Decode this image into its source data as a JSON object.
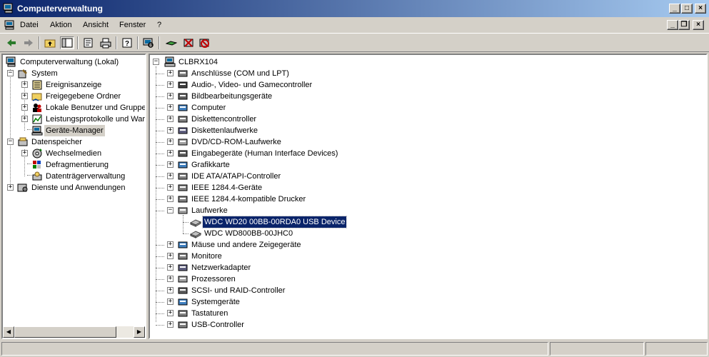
{
  "window": {
    "title": "Computerverwaltung"
  },
  "title_buttons": {
    "minimize": "_",
    "maximize": "□",
    "close": "×"
  },
  "menu": [
    {
      "label": "Datei"
    },
    {
      "label": "Aktion"
    },
    {
      "label": "Ansicht"
    },
    {
      "label": "Fenster"
    },
    {
      "label": "?"
    }
  ],
  "doc_buttons": {
    "minimize": "_",
    "restore": "❐",
    "close": "×"
  },
  "left_tree": {
    "root": "Computerverwaltung (Lokal)",
    "system": "System",
    "ereignisanzeige": "Ereignisanzeige",
    "freigegebene_ordner": "Freigegebene Ordner",
    "lokale_benutzer": "Lokale Benutzer und Gruppen",
    "leistungsprotokolle": "Leistungsprotokolle und Warnungen",
    "geraete_manager": "Geräte-Manager",
    "datenspeicher": "Datenspeicher",
    "wechselmedien": "Wechselmedien",
    "defragmentierung": "Defragmentierung",
    "datentraegerverwaltung": "Datenträgerverwaltung",
    "dienste": "Dienste und Anwendungen"
  },
  "right_tree": {
    "computer": "CLBRX104",
    "categories": [
      "Anschlüsse (COM und LPT)",
      "Audio-, Video- und Gamecontroller",
      "Bildbearbeitungsgeräte",
      "Computer",
      "Diskettencontroller",
      "Diskettenlaufwerke",
      "DVD/CD-ROM-Laufwerke",
      "Eingabegeräte (Human Interface Devices)",
      "Grafikkarte",
      "IDE ATA/ATAPI-Controller",
      "IEEE 1284.4-Geräte",
      "IEEE 1284.4-kompatible Drucker",
      "Laufwerke"
    ],
    "drives": [
      "WDC WD20 00BB-00RDA0 USB Device",
      "WDC WD800BB-00JHC0"
    ],
    "categories_after": [
      "Mäuse und andere Zeigegeräte",
      "Monitore",
      "Netzwerkadapter",
      "Prozessoren",
      "SCSI- und RAID-Controller",
      "Systemgeräte",
      "Tastaturen",
      "USB-Controller"
    ]
  },
  "tree_glyphs": {
    "plus": "+",
    "minus": "−"
  },
  "scroll_glyphs": {
    "left": "◀",
    "right": "▶"
  }
}
